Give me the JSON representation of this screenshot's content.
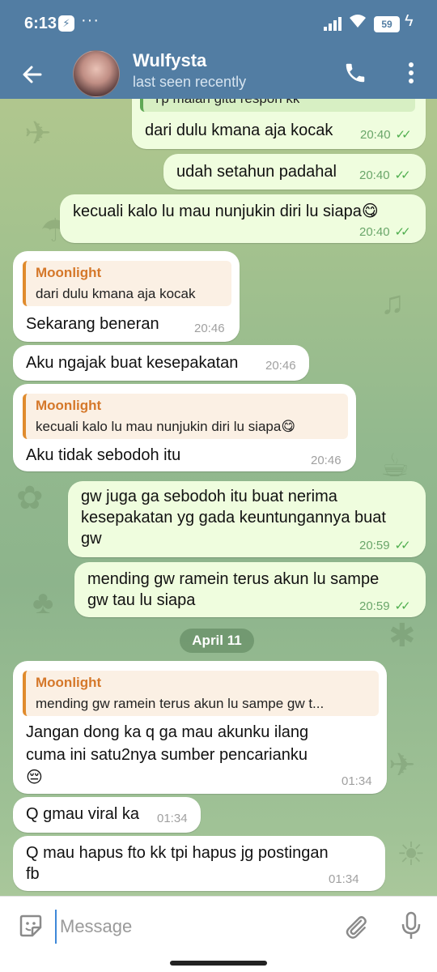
{
  "status_bar": {
    "time": "6:13",
    "dots": "···",
    "battery": "59"
  },
  "header": {
    "name": "Wulfysta",
    "status": "last seen recently"
  },
  "messages": [
    {
      "type": "out",
      "reply_text": "Tp malah gitu respon kk",
      "text": "dari dulu kmana aja kocak",
      "time": "20:40"
    },
    {
      "type": "out",
      "text": "udah setahun padahal",
      "time": "20:40"
    },
    {
      "type": "out",
      "text": "kecuali kalo lu mau nunjukin diri lu siapa😋",
      "time": "20:40"
    },
    {
      "type": "in",
      "reply_name": "Moonlight",
      "reply_text": "dari dulu kmana aja kocak",
      "text": "Sekarang beneran",
      "time": "20:46"
    },
    {
      "type": "in",
      "text": "Aku ngajak buat kesepakatan",
      "time": "20:46"
    },
    {
      "type": "in",
      "reply_name": "Moonlight",
      "reply_text": "kecuali kalo lu mau nunjukin diri lu siapa😋",
      "text": "Aku tidak sebodoh itu",
      "time": "20:46"
    },
    {
      "type": "out",
      "line1": "gw juga ga sebodoh itu buat nerima",
      "line2": "kesepakatan yg gada keuntungannya buat",
      "line3": "gw",
      "time": "20:59"
    },
    {
      "type": "out",
      "line1": "mending gw ramein terus akun lu sampe",
      "line2": "gw tau lu siapa",
      "time": "20:59"
    },
    {
      "type": "date",
      "text": "April 11"
    },
    {
      "type": "in",
      "reply_name": "Moonlight",
      "reply_text": "mending gw ramein terus akun lu sampe gw t...",
      "line1": "Jangan dong ka q ga mau akunku ilang",
      "line2": "cuma ini satu2nya sumber pencarianku",
      "line3": "😔",
      "time": "01:34"
    },
    {
      "type": "in",
      "text": "Q gmau viral ka",
      "time": "01:34"
    },
    {
      "type": "in",
      "line1": "Q mau hapus fto kk tpi hapus jg postingan",
      "line2": "fb",
      "time": "01:34"
    }
  ],
  "input": {
    "placeholder": "Message"
  },
  "icons": {
    "back": "arrow-left-icon",
    "call": "phone-icon",
    "more": "more-vert-icon",
    "emoji": "sticker-emoji-icon",
    "attach": "paperclip-icon",
    "mic": "microphone-icon"
  },
  "colors": {
    "header": "#527da3",
    "outgoing": "#effdde",
    "incoming": "#ffffff",
    "reply_accent": "#e08b2d",
    "ticks": "#4fae4e"
  }
}
